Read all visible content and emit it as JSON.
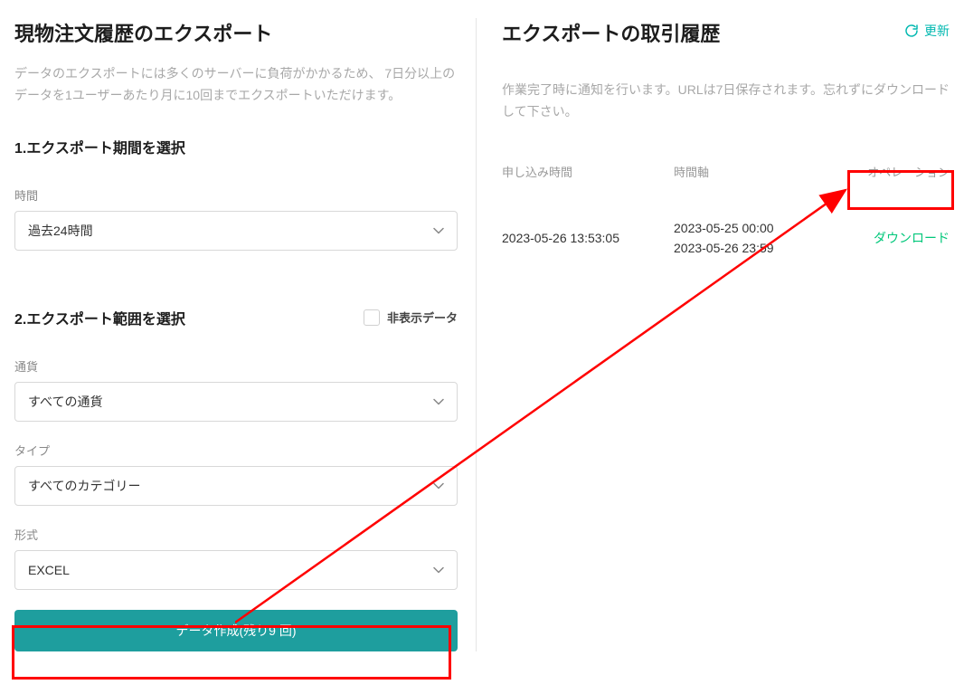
{
  "left": {
    "title": "現物注文履歴のエクスポート",
    "description": "データのエクスポートには多くのサーバーに負荷がかかるため、 7日分以上のデータを1ユーザーあたり月に10回までエクスポートいただけます。",
    "section1_title": "1.エクスポート期間を選択",
    "section2_title": "2.エクスポート範囲を選択",
    "hidden_data_label": "非表示データ",
    "fields": {
      "time": {
        "label": "時間",
        "value": "過去24時間"
      },
      "currency": {
        "label": "通貨",
        "value": "すべての通貨"
      },
      "type": {
        "label": "タイプ",
        "value": "すべてのカテゴリー"
      },
      "format": {
        "label": "形式",
        "value": "EXCEL"
      }
    },
    "submit_label": "データ作成(残り9 回)"
  },
  "right": {
    "title": "エクスポートの取引履歴",
    "refresh_label": "更新",
    "description": "作業完了時に通知を行います。URLは7日保存されます。忘れずにダウンロードして下さい。",
    "columns": {
      "apply_time": "申し込み時間",
      "time_axis": "時間軸",
      "operation": "オペレーション"
    },
    "rows": [
      {
        "apply_time": "2023-05-26 13:53:05",
        "axis_start": "2023-05-25 00:00",
        "axis_end": "2023-05-26 23:59",
        "operation": "ダウンロード"
      }
    ]
  }
}
